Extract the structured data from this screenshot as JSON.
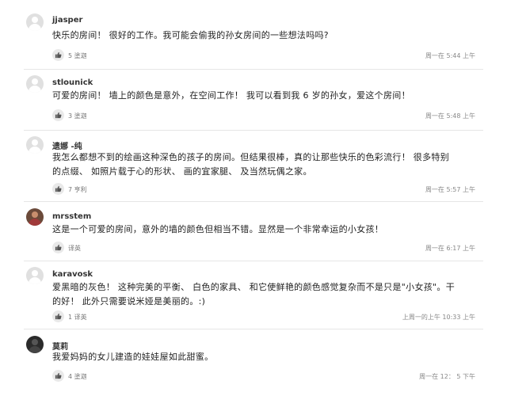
{
  "comments": [
    {
      "user": "jjasper",
      "avatar": "default-avatar-icon",
      "text": "快乐的房间！ 很好的工作。我可能会偷我的孙女房间的一些想法吗吗?",
      "likes": "5 塗迦",
      "time": "周一在 5:44 上午"
    },
    {
      "user": "stlounick",
      "avatar": "default-avatar-icon",
      "text": "可爱的房间！ 墙上的颜色是意外，在空间工作！ 我可以看到我 6 岁的孙女，爱这个房间！",
      "likes": "3 塗迦",
      "time": "周一在 5:48 上午"
    },
    {
      "user": "遗娜 -纯",
      "avatar": "default-avatar-icon",
      "text": "我怎么都想不到的绘画这种深色的孩子的房间。但结果很棒，真的让那些快乐的色彩流行！ 很多特别的点缀、 如照片载于心的形状、 画的宜家腿、 及当然玩偶之家。",
      "likes": "7 亨利",
      "time": "周一在 5:57 上午"
    },
    {
      "user": "mrsstem",
      "avatar": "photo-avatar-icon",
      "text": "这是一个可爱的房间，意外的墙的颜色但相当不错。显然是一个非常幸运的小女孩！",
      "likes": "译英",
      "time": "周一在 6:17 上午"
    },
    {
      "user": "karavosk",
      "avatar": "default-avatar-icon",
      "text": "爱黑暗的灰色！ 这种完美的平衡、 白色的家具、 和它使鲜艳的颜色感觉复杂而不是只是\"小女孩\"。干的好！ 此外只需要说米娅是美丽的。:)",
      "likes": "1 译英",
      "time": "上周一的上午 10:33 上午"
    },
    {
      "user": "莫莉",
      "avatar": "dark-avatar-icon",
      "text": "我爱妈妈的女儿建造的娃娃屋如此甜蜜。",
      "likes": "4 塗迦",
      "time": "周一在 12： 5 下午"
    }
  ]
}
